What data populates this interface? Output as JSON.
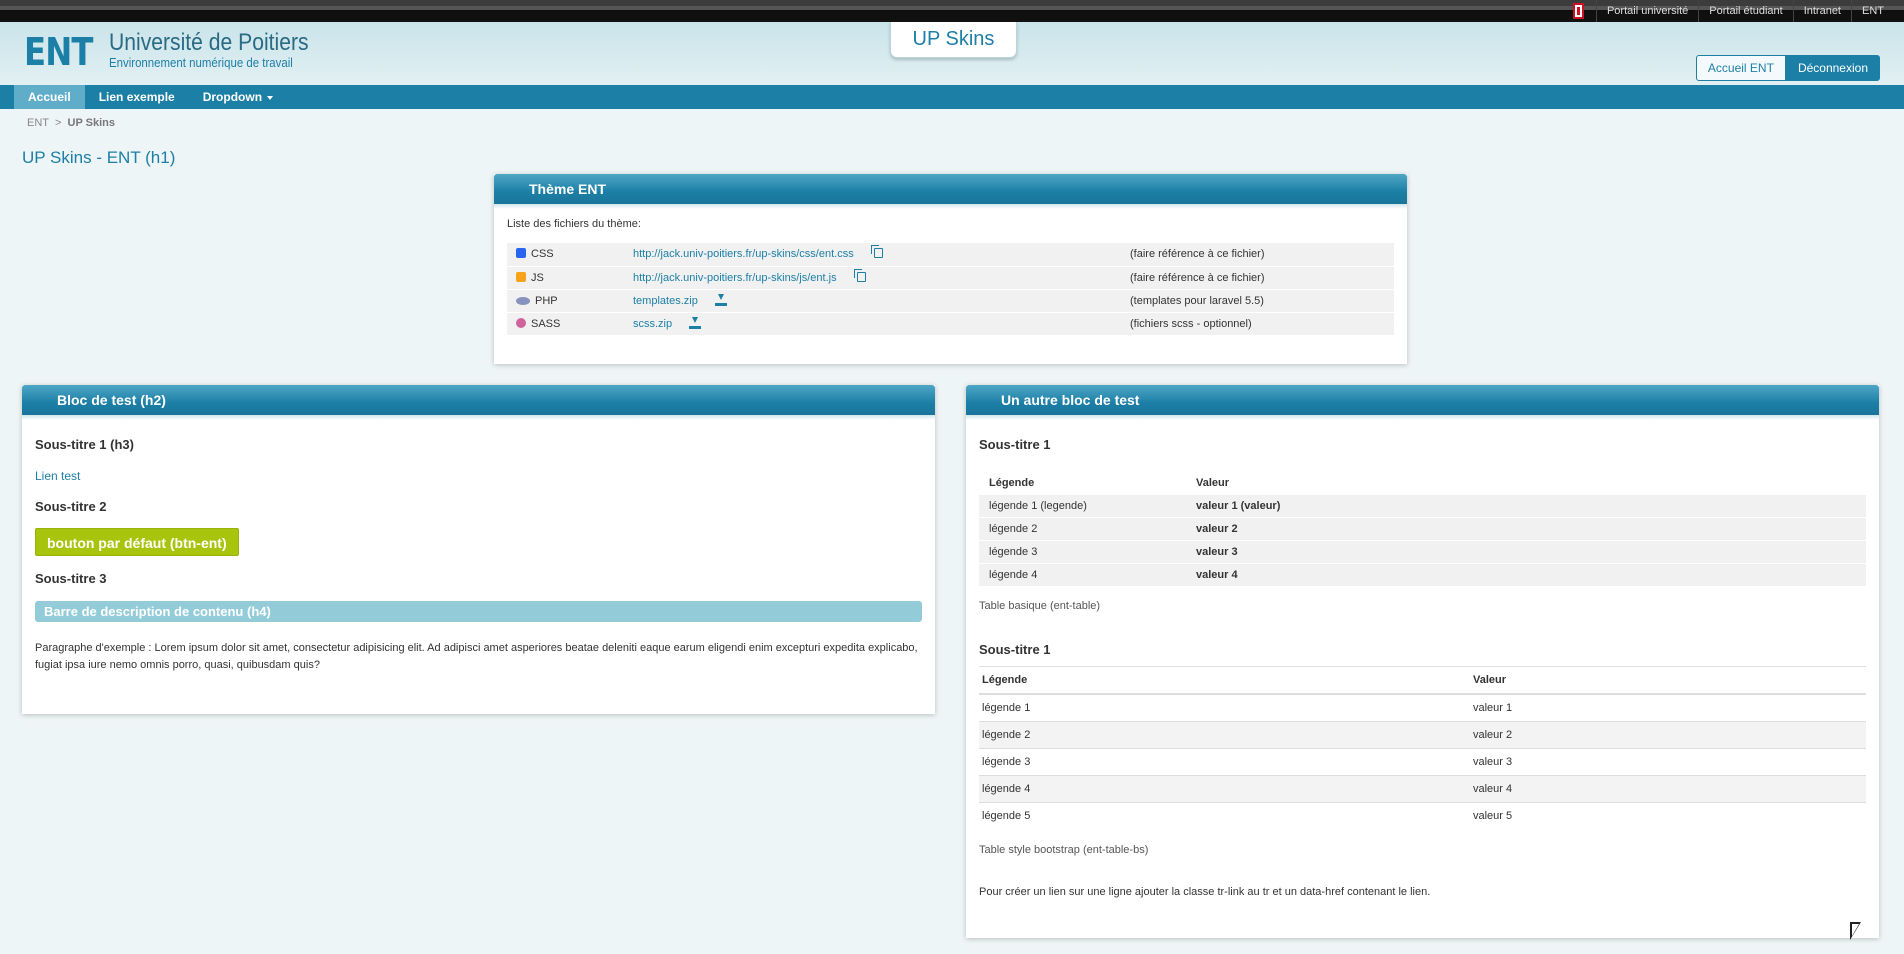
{
  "topbar": {
    "links": [
      "Portail université",
      "Portail étudiant",
      "Intranet",
      "ENT"
    ]
  },
  "header": {
    "logo_ent": "ENT",
    "logo_university": "Université de Poitiers",
    "logo_tagline": "Environnement numérique de travail",
    "skin_tab": "UP Skins",
    "btn_home": "Accueil ENT",
    "btn_logout": "Déconnexion"
  },
  "nav": {
    "items": [
      {
        "label": "Accueil"
      },
      {
        "label": "Lien exemple"
      },
      {
        "label": "Dropdown"
      }
    ]
  },
  "breadcrumb": {
    "root": "ENT",
    "sep": ">",
    "current": "UP Skins"
  },
  "page_title": "UP Skins - ENT (h1)",
  "theme": {
    "title": "Thème ENT",
    "intro": "Liste des fichiers du thème:",
    "files": [
      {
        "type": "CSS",
        "icon": "css3-icon",
        "link": "http://jack.univ-poitiers.fr/up-skins/css/ent.css",
        "action": "copy-icon",
        "note": "(faire référence à ce fichier)"
      },
      {
        "type": "JS",
        "icon": "js-icon",
        "link": "http://jack.univ-poitiers.fr/up-skins/js/ent.js",
        "action": "copy-icon",
        "note": "(faire référence à ce fichier)"
      },
      {
        "type": "PHP",
        "icon": "php-icon",
        "link": "templates.zip",
        "action": "download-icon",
        "note": "(templates pour laravel 5.5)"
      },
      {
        "type": "SASS",
        "icon": "sass-icon",
        "link": "scss.zip",
        "action": "download-icon",
        "note": "(fichiers scss - optionnel)"
      }
    ]
  },
  "bloc1": {
    "title": "Bloc de test (h2)",
    "sub1": "Sous-titre 1 (h3)",
    "link": "Lien test",
    "sub2": "Sous-titre 2",
    "button": "bouton par défaut (btn-ent)",
    "sub3": "Sous-titre 3",
    "desc_bar": "Barre de description de contenu (h4)",
    "paragraph": "Paragraphe d'exemple : Lorem ipsum dolor sit amet, consectetur adipisicing elit. Ad adipisci amet asperiores beatae deleniti eaque earum eligendi enim excepturi expedita explicabo, fugiat ipsa iure nemo omnis porro, quasi, quibusdam quis?"
  },
  "bloc2": {
    "title": "Un autre bloc de test",
    "sub1": "Sous-titre 1",
    "table1": {
      "headers": [
        "Légende",
        "Valeur"
      ],
      "rows": [
        [
          "légende 1 (legende)",
          "valeur 1 (valeur)"
        ],
        [
          "légende 2",
          "valeur 2"
        ],
        [
          "légende 3",
          "valeur 3"
        ],
        [
          "légende 4",
          "valeur 4"
        ]
      ]
    },
    "caption1": "Table basique (ent-table)",
    "sub2": "Sous-titre 1",
    "table2": {
      "headers": [
        "Légende",
        "Valeur"
      ],
      "rows": [
        [
          "légende 1",
          "valeur 1"
        ],
        [
          "légende 2",
          "valeur 2"
        ],
        [
          "légende 3",
          "valeur 3"
        ],
        [
          "légende 4",
          "valeur 4"
        ],
        [
          "légende 5",
          "valeur 5"
        ]
      ]
    },
    "caption2": "Table style bootstrap (ent-table-bs)",
    "note": "Pour créer un lien sur une ligne ajouter la classe tr-link au tr et un data-href contenant le lien."
  },
  "colors": {
    "primary": "#1c7fa6",
    "button": "#a8c40d",
    "desc_bar": "#93ccd8"
  }
}
